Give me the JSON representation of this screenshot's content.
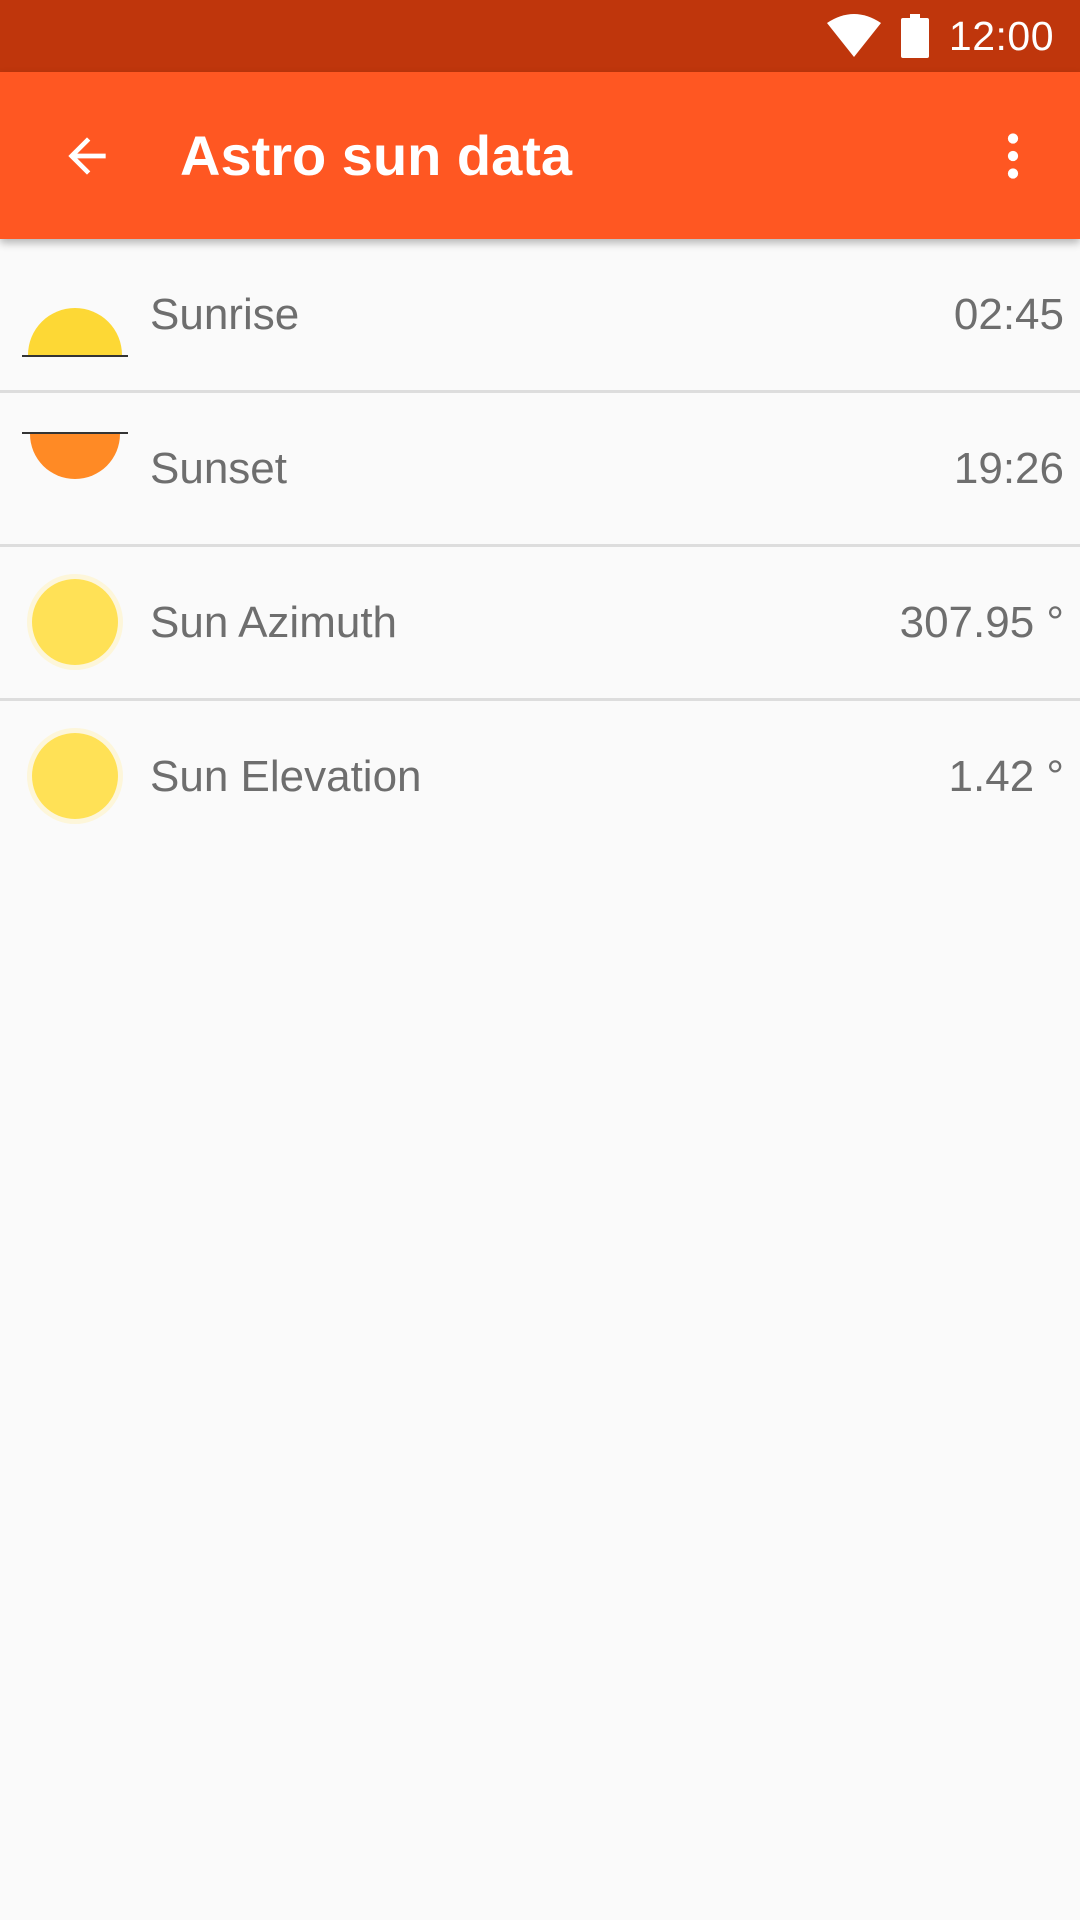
{
  "status_bar": {
    "time": "12:00",
    "icons": [
      "wifi-icon",
      "battery-icon"
    ],
    "background": "#BF360C"
  },
  "app_bar": {
    "title": "Astro sun data",
    "back_icon": "arrow-back-icon",
    "menu_icon": "more-vert-icon",
    "background": "#FF5722"
  },
  "items": [
    {
      "label": "Sunrise",
      "value": "02:45",
      "icon": "sunrise-icon"
    },
    {
      "label": "Sunset",
      "value": "19:26",
      "icon": "sunset-icon"
    },
    {
      "label": "Sun Azimuth",
      "value": "307.95 °",
      "icon": "sun-icon"
    },
    {
      "label": "Sun Elevation",
      "value": "1.42 °",
      "icon": "sun-icon"
    }
  ],
  "colors": {
    "sun_yellow": "#FDD835",
    "sunset_orange": "#FF8A25",
    "text_secondary": "#6E6E6E"
  }
}
